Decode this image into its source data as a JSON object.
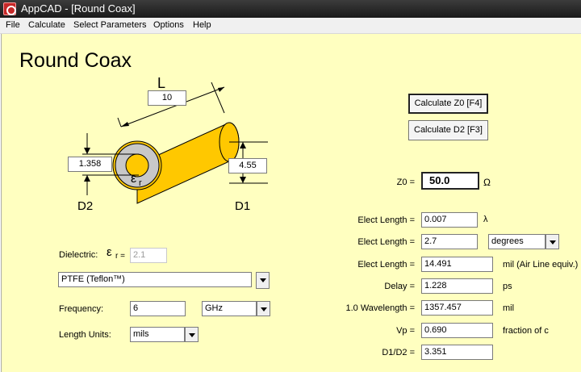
{
  "window": {
    "title": "AppCAD - [Round Coax]"
  },
  "menu": [
    {
      "label": "File"
    },
    {
      "label": "Calculate"
    },
    {
      "label": "Select Parameters"
    },
    {
      "label": "Options"
    },
    {
      "label": "Help"
    }
  ],
  "page": {
    "title": "Round Coax"
  },
  "diagram": {
    "length_label": "L",
    "length_value": "10",
    "d2_value": "1.358",
    "d1_value": "4.55",
    "d2_label": "D2",
    "d1_label": "D1",
    "epsilon_symbol": "ε",
    "epsilon_sub": "r"
  },
  "buttons": {
    "calc_z0": "Calculate Z0  [F4]",
    "calc_d2": "Calculate D2  [F3]"
  },
  "dielectric": {
    "label": "Dielectric:",
    "er_symbol": "ε",
    "er_suffix": "r =",
    "er_value": "2.1",
    "material": "PTFE  (Teflon™)"
  },
  "frequency": {
    "label": "Frequency:",
    "value": "6",
    "unit": "GHz"
  },
  "length_units": {
    "label": "Length Units:",
    "value": "mils"
  },
  "results": {
    "z0_label": "Z0 =",
    "z0_value": "50.0",
    "z0_unit": "Ω",
    "elect_len_wl_label": "Elect Length =",
    "elect_len_wl_value": "0.007",
    "elect_len_wl_unit": "λ",
    "elect_len_deg_label": "Elect Length =",
    "elect_len_deg_value": "2.7",
    "elect_len_deg_unit": "degrees",
    "elect_len_mil_label": "Elect Length =",
    "elect_len_mil_value": "14.491",
    "elect_len_mil_unit": "mil  (Air Line equiv.)",
    "delay_label": "Delay =",
    "delay_value": "1.228",
    "delay_unit": "ps",
    "wavelength_label": "1.0 Wavelength =",
    "wavelength_value": "1357.457",
    "wavelength_unit": "mil",
    "vp_label": "Vp =",
    "vp_value": "0.690",
    "vp_unit": "fraction of c",
    "ratio_label": "D1/D2 =",
    "ratio_value": "3.351"
  },
  "colors": {
    "background": "#ffffc0",
    "conductor": "#ffc800",
    "dielectric": "#c8c8c8"
  }
}
